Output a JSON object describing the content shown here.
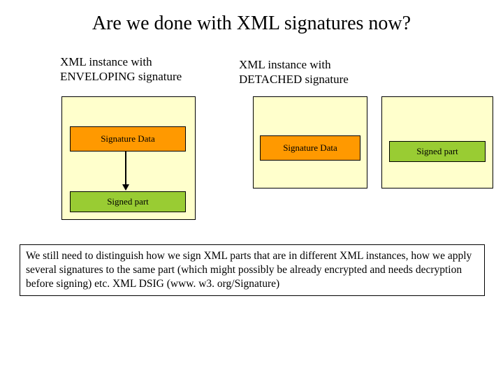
{
  "title": "Are we done with XML signatures now?",
  "left": {
    "label_line1": "XML instance with",
    "label_line2": "ENVELOPING signature",
    "signature": "Signature Data",
    "signed": "Signed part"
  },
  "right": {
    "label_line1": "XML instance with",
    "label_line2": "DETACHED signature",
    "signature": "Signature Data",
    "signed": "Signed part"
  },
  "footer": "We still need to distinguish how we sign XML parts that are in different XML instances, how we apply several signatures to the same part (which might possibly be already encrypted and needs decryption before signing) etc. XML DSIG (www. w3. org/Signature)"
}
